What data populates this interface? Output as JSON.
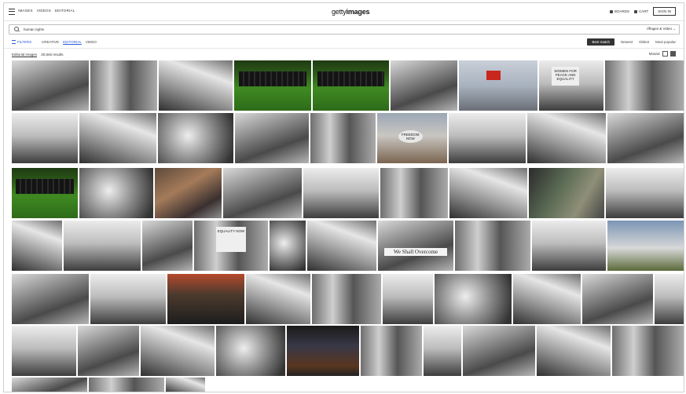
{
  "nav": {
    "links": [
      "Images",
      "Videos",
      "Editorial"
    ],
    "logo_light": "getty",
    "logo_bold": "images",
    "right": [
      "Boards",
      "Cart"
    ],
    "signin": "Sign in"
  },
  "search": {
    "value": "human rights",
    "scope": "Images & Video"
  },
  "filters": {
    "label": "Filters",
    "types": [
      "Creative",
      "Editorial",
      "Video"
    ],
    "active_type": "Editorial",
    "sort": [
      "Best match",
      "Newest",
      "Oldest",
      "Most popular"
    ],
    "active_sort": "Best match"
  },
  "results": {
    "label": "Editorial images",
    "count": "20,846 results"
  },
  "view": {
    "label": "Mosaic"
  },
  "images": {
    "row1": [
      "protest-crowd",
      "march-crowd",
      "march-leaders",
      "football-team-kneel",
      "football-team-kneel-2",
      "protest-signs",
      "chinese-flag-barbed-wire",
      "women-for-peace-signs",
      "protest-march"
    ],
    "row2": [
      "woman-reading-document",
      "police-water-hose",
      "two-men-portrait",
      "speakers-at-rally",
      "eleanor-document",
      "button-closeup",
      "march-placards",
      "crowd-speech",
      "woman-on-phone"
    ],
    "row3": [
      "football-team-line",
      "hands-reaching",
      "leaders-marching",
      "march-front-row",
      "civil-rights-field",
      "protest-crowd-2",
      "american-flags",
      "police-arrest",
      "capitol-march"
    ],
    "row4": [
      "politicians-meeting",
      "lincoln-memorial-crowd",
      "man-kneeling",
      "equality-signs",
      "sit-in-protest",
      "we-shall-overcome",
      "march-line",
      "protest-signs-2",
      "color-protest-photos"
    ],
    "row5": [
      "police-arrest-2",
      "car-street",
      "egypt-flag-protest",
      "massive-crowd",
      "marchers-flags",
      "man-writing",
      "mugshot-portrait",
      "smoke-street",
      "police-officer"
    ],
    "row6": [
      "classroom",
      "mens-shirts",
      "woman-holding-photo",
      "smoke-fire",
      "men-in-suits-color",
      "crowd-aerial",
      "dancing-figure",
      "sidewalk-march",
      "police-scene"
    ]
  },
  "overlay_text": {
    "we_shall_overcome": "We Shall Overcome",
    "women_for_peace": "WOMEN FOR PEACE AND EQUALITY",
    "equality": "EQUALITY NOW",
    "button_text": "FREEDOM NOW"
  }
}
